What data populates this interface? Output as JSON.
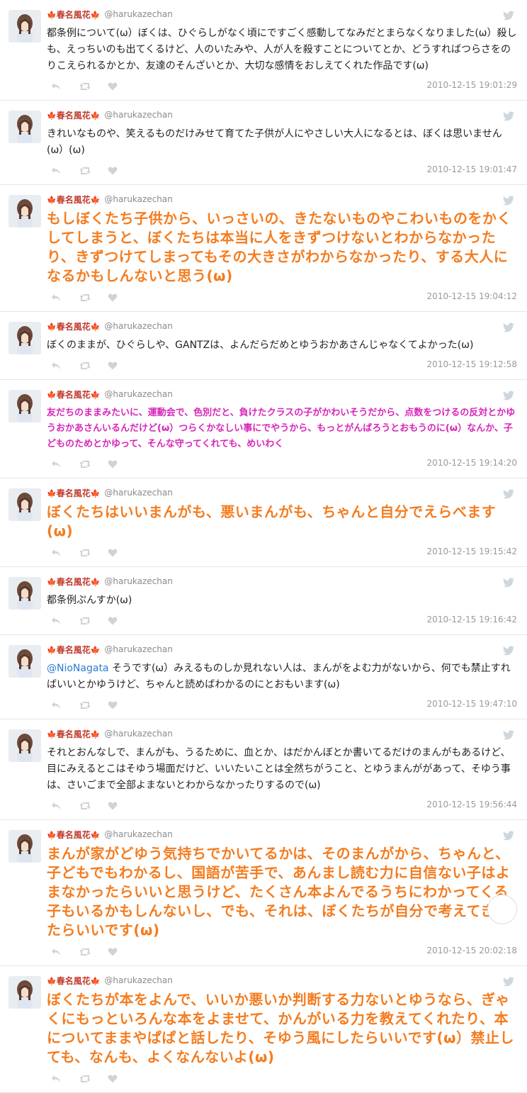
{
  "user": {
    "display_name": "春名風花",
    "handle": "@harukazechan"
  },
  "tweets": [
    {
      "style": "normal",
      "text": "都条例について(ω）ぼくは、ひぐらしがなく頃にですごく感動してなみだとまらなくなりました(ω）殺しも、えっちいのも出てくるけど、人のいたみや、人が人を殺すことについてとか、どうすればつらさをのりこえられるかとか、友達のそんざいとか、大切な感情をおしえてくれた作品です(ω)",
      "timestamp": "2010-12-15 19:01:29"
    },
    {
      "style": "normal",
      "text": "きれいなものや、笑えるものだけみせて育てた子供が人にやさしい大人になるとは、ぼくは思いません(ω）(ω)",
      "timestamp": "2010-12-15 19:01:47"
    },
    {
      "style": "big-orange",
      "text": "もしぼくたち子供から、いっさいの、きたないものやこわいものをかくしてしまうと、ぼくたちは本当に人をきずつけないとわからなかったり、きずつけてしまってもその大きさがわからなかったり、する大人になるかもしんないと思う(ω)",
      "timestamp": "2010-12-15 19:04:12"
    },
    {
      "style": "normal",
      "text": "ぼくのままが、ひぐらしや、GANTZは、よんだらだめとゆうおかあさんじゃなくてよかった(ω)",
      "timestamp": "2010-12-15 19:12:58"
    },
    {
      "style": "magenta",
      "text": "友だちのままみたいに、運動会で、色別だと、負けたクラスの子がかわいそうだから、点数をつけるの反対とかゆうおかあさんいるんだけど(ω）つらくかなしい事にでやうから、もっとがんばろうとおもうのに(ω）なんか、子どものためとかゆって、そんな守ってくれても、めいわく",
      "timestamp": "2010-12-15 19:14:20"
    },
    {
      "style": "big-orange",
      "text": "ぼくたちはいいまんがも、悪いまんがも、ちゃんと自分でえらべます(ω)",
      "timestamp": "2010-12-15 19:15:42"
    },
    {
      "style": "normal",
      "text": "都条例ぷんすか(ω)",
      "timestamp": "2010-12-15 19:16:42"
    },
    {
      "style": "normal",
      "mention": "@NioNagata",
      "text": " そうです(ω）みえるものしか見れない人は、まんがをよむ力がないから、何でも禁止すればいいとかゆうけど、ちゃんと読めばわかるのにとおもいます(ω)",
      "timestamp": "2010-12-15 19:47:10"
    },
    {
      "style": "normal",
      "text": "それとおんなしで、まんがも、うるために、血とか、はだかんぼとか書いてるだけのまんがもあるけど、目にみえるとこはそゆう場面だけど、いいたいことは全然ちがうこと、とゆうまんががあって、そゆう事は、さいごまで全部よまないとわからなかったりするので(ω)",
      "timestamp": "2010-12-15 19:56:44"
    },
    {
      "style": "big-orange",
      "text": "まんが家がどゆう気持ちでかいてるかは、そのまんがから、ちゃんと、子どもでもわかるし、国語が苦手で、あんまし読む力に自信ない子はよまなかったらいいと思うけど、たくさん本よんでるうちにわかってくる子もいるかもしんないし、でも、それは、ぼくたちが自分で考えてきめたらいいです(ω)",
      "timestamp": "2010-12-15 20:02:18"
    },
    {
      "style": "big-orange",
      "text": "ぼくたちが本をよんで、いいか悪いか判断する力ないとゆうなら、ぎゃくにもっといろんな本をよませて、かんがいる力を教えてくれたり、本についてままやぱぱと話したり、そゆう風にしたらいいです(ω）禁止しても、なんも、よくなんないよ(ω)",
      "timestamp": ""
    }
  ],
  "colors": {
    "orange": "#f47c1f",
    "magenta": "#d726b8",
    "link": "#2a7bd1",
    "name": "#c0392b"
  },
  "icons": [
    "avatar",
    "maple-leaf-icon",
    "twitter-bird-icon",
    "reply-icon",
    "retweet-icon",
    "favorite-icon",
    "scroll-up-icon"
  ]
}
